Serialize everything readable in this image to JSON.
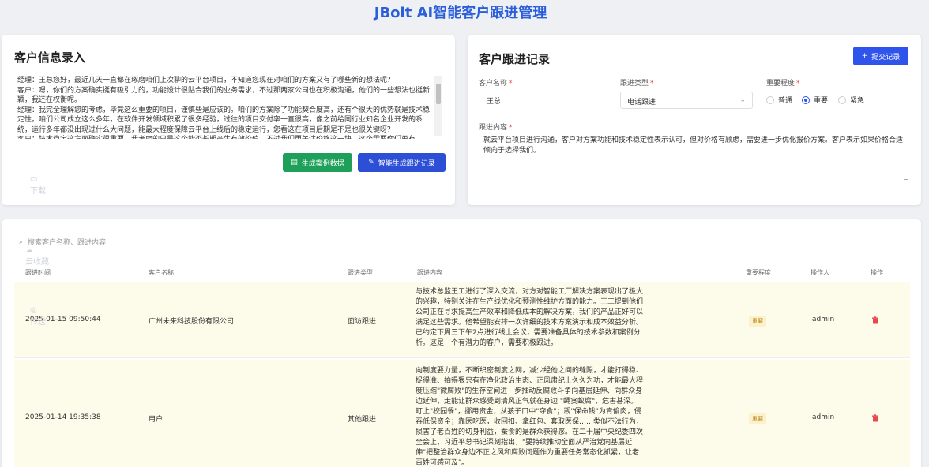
{
  "app_title": "JBolt AI智能客户跟进管理",
  "left_card": {
    "title": "客户信息录入",
    "transcript": "经理：王总您好，最近几天一直都在琢磨咱们上次聊的云平台项目，不知道您现在对咱们的方案又有了哪些新的想法呢？\n客户：嗯，你们的方案确实挺有吸引力的，功能设计很贴合我们的业务需求，不过那两家公司也在积极沟通，他们的一些想法也挺新颖，我还在权衡呢。\n经理：我完全理解您的考虑，毕竟这么重要的项目，谨慎些是应该的。咱们的方案除了功能契合度高，还有个很大的优势就是技术稳定性。咱们公司成立这么多年，在软件开发领域积累了很多经验，过往的项目交付率一直很高，像之前给同行业知名企业开发的系统，运行多年都没出现过什么大问题，能最大程度保障云平台上线后的稳定运行，您看这在项目后期是不是也很关键呀？\n客户：技术稳定这方面确实很重要，我考虑的只是这个能否长期产生有效价值，不过我们更关注价格这一块，这个需要你们再有",
    "btn_sample": "生成案例数据",
    "btn_generate": "智能生成跟进记录"
  },
  "right_card": {
    "title": "客户跟进记录",
    "btn_submit": "提交记录",
    "customer_label": "客户名称",
    "customer_value": "王总",
    "type_label": "跟进类型",
    "type_value": "电话跟进",
    "importance_label": "重要程度",
    "importance_options": [
      "普通",
      "重要",
      "紧急"
    ],
    "content_label": "跟进内容",
    "content_value": "就云平台项目进行沟通，客户对方案功能和技术稳定性表示认可，但对价格有顾虑，需要进一步优化报价方案。客户表示如果价格合适倾向于选择我们。"
  },
  "table": {
    "search_placeholder": "搜索客户名称、跟进内容",
    "headers": [
      "跟进时间",
      "客户名称",
      "跟进类型",
      "跟进内容",
      "重要程度",
      "操作人",
      "操作"
    ],
    "rows": [
      {
        "time": "2025-01-15 09:50:44",
        "customer": "广州未来科技股份有限公司",
        "type": "面访跟进",
        "content": "与技术总监王工进行了深入交流，对方对智能工厂解决方案表现出了极大的兴趣，特别关注在生产线优化和预测性维护方面的能力。王工提到他们公司正在寻求提高生产效率和降低成本的解决方案，我们的产品正好可以满足这些需求。他希望能安排一次详细的技术方案演示和成本效益分析。已约定下周三下午2点进行线上会议，需要准备具体的技术参数和案例分析。这是一个有潜力的客户，需要积极跟进。",
        "importance": "重要",
        "operator": "admin"
      },
      {
        "time": "2025-01-14 19:35:38",
        "customer": "用户",
        "type": "其他跟进",
        "content": "向制度要力量，不断织密制度之网，减少经他之间的缝隙，才能打得稳、捉得准、拍得狠只有在净化政治生态、正风肃纪上久久为功，才能最大程度压缩\"微腐败\"的生存空间进一步推动反腐败斗争向基层延伸、向群众身边延伸，走能让群众感受到清风正气就在身边 \"蝇贪蚁腐\"，危害甚深。盯上\"校园餐\"，挪用资金，从孩子口中\"夺食\"；觊\"保命钱\"为青偷肉，侵吞低保资金；靠医吃医，收回扣、拿红包、套取医保……类似不法行为，损害了老百姓的切身利益，蚕食的是群众获得感。在二十届中央纪委四次全会上，习近平总书记深刻指出，\"要持续推动全面从严治党向基层延伸\"把整治群众身边不正之风和腐败问题作为重要任务常态化抓紧，让老百姓可感可及\"。",
        "importance": "重要",
        "operator": "admin"
      }
    ]
  },
  "desktop_overlay": {
    "download": "下载",
    "cloud": "云收藏",
    "share": "传送"
  },
  "colors": {
    "accent": "#2f54eb",
    "green": "#1fa05a",
    "title": "#2b5fd9",
    "danger": "#e5484d"
  }
}
